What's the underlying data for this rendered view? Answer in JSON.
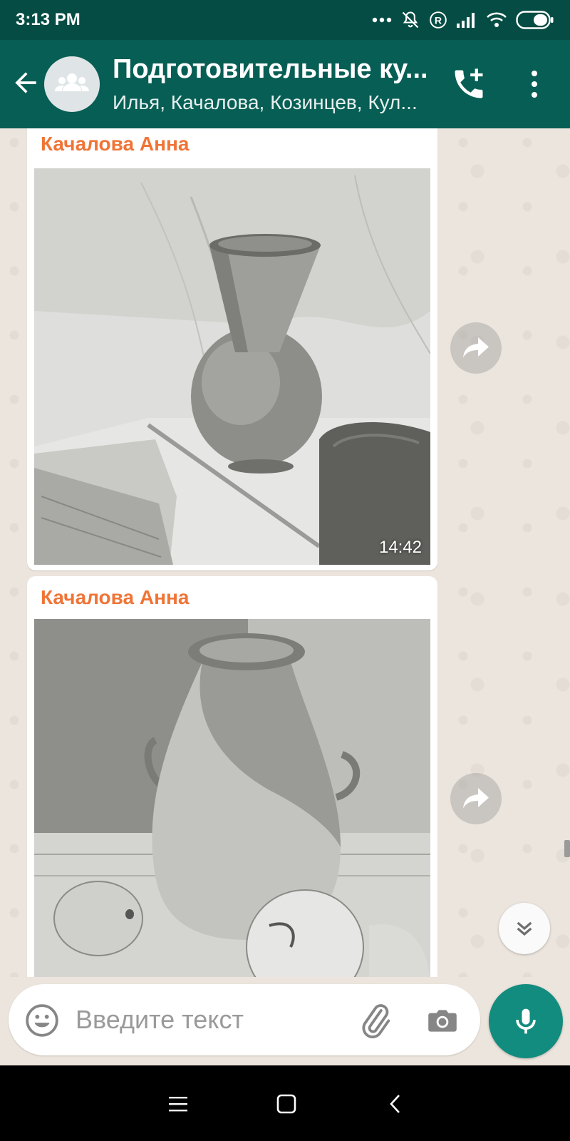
{
  "status_bar": {
    "time": "3:13 PM",
    "icons": [
      "more-dots-icon",
      "mute-icon",
      "registered-icon",
      "signal-icon",
      "wifi-icon",
      "battery-icon"
    ]
  },
  "header": {
    "title": "Подготовительные ку...",
    "subtitle": "Илья, Качалова, Козинцев, Кул...",
    "icons": [
      "back-arrow-icon",
      "group-avatar-icon",
      "add-call-icon",
      "more-vert-icon"
    ]
  },
  "messages": [
    {
      "sender": "Качалова Анна",
      "type": "photo",
      "timestamp": "14:42",
      "forwardable": true
    },
    {
      "sender": "Качалова Анна",
      "type": "photo",
      "timestamp": "",
      "forwardable": true
    }
  ],
  "input": {
    "placeholder": "Введите текст",
    "value": ""
  },
  "colors": {
    "status_bar": "#054d44",
    "header": "#075e54",
    "sender_name": "#f07436",
    "mic_button": "#128c7e",
    "chat_background": "#ece5dd"
  },
  "nav": {
    "icons": [
      "menu-icon",
      "home-icon",
      "back-icon"
    ]
  }
}
